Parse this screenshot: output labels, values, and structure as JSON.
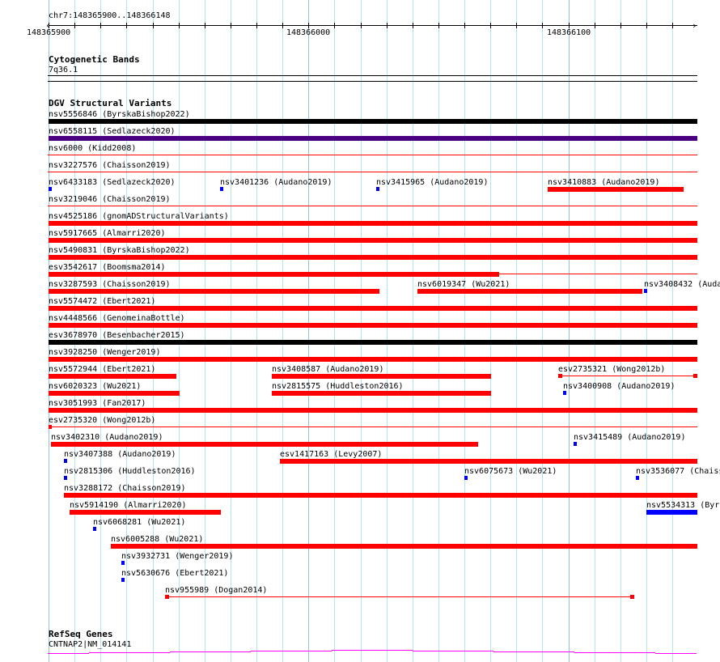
{
  "ruler": {
    "location": "chr7:148365900..148366148",
    "tick_labels": [
      "148365900",
      "148366000",
      "148366100"
    ]
  },
  "cytoband": {
    "title": "Cytogenetic Bands",
    "band": "7q36.1"
  },
  "dgv": {
    "title": "DGV Structural Variants",
    "colors": {
      "red": "#ff0000",
      "blue": "#0000ff",
      "black": "#000000",
      "purple": "#4b0082"
    },
    "rows": [
      {
        "items": [
          {
            "label": "nsv5556846 (ByrskaBishop2022)",
            "color": "#000000"
          }
        ]
      },
      {
        "items": [
          {
            "label": "nsv6558115 (Sedlazeck2020)",
            "color": "#4b0082"
          }
        ]
      },
      {
        "items": [
          {
            "label": "nsv6000 (Kidd2008)",
            "color": "#ff0000"
          }
        ]
      },
      {
        "items": [
          {
            "label": "nsv3227576 (Chaisson2019)",
            "color": "#ff0000"
          }
        ]
      },
      {
        "items": [
          {
            "label": "nsv6433183 (Sedlazeck2020)",
            "color": "#0000ff"
          },
          {
            "label": "nsv3401236 (Audano2019)",
            "color": "#0000ff"
          },
          {
            "label": "nsv3415965 (Audano2019)",
            "color": "#0000ff"
          },
          {
            "label": "nsv3410883 (Audano2019)",
            "color": "#ff0000"
          }
        ]
      },
      {
        "items": [
          {
            "label": "nsv3219046 (Chaisson2019)",
            "color": "#ff0000"
          }
        ]
      },
      {
        "items": [
          {
            "label": "nsv4525186 (gnomADStructuralVariants)",
            "color": "#ff0000"
          }
        ]
      },
      {
        "items": [
          {
            "label": "nsv5917665 (Almarri2020)",
            "color": "#ff0000"
          }
        ]
      },
      {
        "items": [
          {
            "label": "nsv5490831 (ByrskaBishop2022)",
            "color": "#ff0000"
          }
        ]
      },
      {
        "items": [
          {
            "label": "esv3542617 (Boomsma2014)",
            "color": "#ff0000"
          }
        ]
      },
      {
        "items": [
          {
            "label": "nsv3287593 (Chaisson2019)",
            "color": "#ff0000"
          },
          {
            "label": "nsv6019347 (Wu2021)",
            "color": "#ff0000"
          },
          {
            "label": "nsv3408432 (Auda",
            "color": "#0000ff"
          }
        ]
      },
      {
        "items": [
          {
            "label": "nsv5574472 (Ebert2021)",
            "color": "#ff0000"
          }
        ]
      },
      {
        "items": [
          {
            "label": "nsv4448566 (GenomeinaBottle)",
            "color": "#ff0000"
          }
        ]
      },
      {
        "items": [
          {
            "label": "esv3678970 (Besenbacher2015)",
            "color": "#000000"
          }
        ]
      },
      {
        "items": [
          {
            "label": "nsv3928250 (Wenger2019)",
            "color": "#ff0000"
          }
        ]
      },
      {
        "items": [
          {
            "label": "nsv5572944 (Ebert2021)",
            "color": "#ff0000"
          },
          {
            "label": "nsv3408587 (Audano2019)",
            "color": "#ff0000"
          },
          {
            "label": "esv2735321 (Wong2012b)",
            "color": "#ff0000"
          }
        ]
      },
      {
        "items": [
          {
            "label": "nsv6020323 (Wu2021)",
            "color": "#ff0000"
          },
          {
            "label": "nsv2815575 (Huddleston2016)",
            "color": "#ff0000"
          },
          {
            "label": "nsv3400908 (Audano2019)",
            "color": "#0000ff"
          }
        ]
      },
      {
        "items": [
          {
            "label": "nsv3051993 (Fan2017)",
            "color": "#ff0000"
          }
        ]
      },
      {
        "items": [
          {
            "label": "esv2735320 (Wong2012b)",
            "color": "#ff0000"
          }
        ]
      },
      {
        "items": [
          {
            "label": "nsv3402310 (Audano2019)",
            "color": "#ff0000"
          },
          {
            "label": "nsv3415489 (Audano2019)",
            "color": "#0000ff"
          }
        ]
      },
      {
        "items": [
          {
            "label": "nsv3407388 (Audano2019)",
            "color": "#0000ff"
          },
          {
            "label": "esv1417163 (Levy2007)",
            "color": "#ff0000"
          }
        ]
      },
      {
        "items": [
          {
            "label": "nsv2815306 (Huddleston2016)",
            "color": "#0000ff"
          },
          {
            "label": "nsv6075673 (Wu2021)",
            "color": "#0000ff"
          },
          {
            "label": "nsv3536077 (Chaiss",
            "color": "#0000ff"
          }
        ]
      },
      {
        "items": [
          {
            "label": "nsv3288172 (Chaisson2019)",
            "color": "#ff0000"
          }
        ]
      },
      {
        "items": [
          {
            "label": "nsv5914190 (Almarri2020)",
            "color": "#ff0000"
          },
          {
            "label": "nsv5534313 (Byrs",
            "color": "#0000ff"
          }
        ]
      },
      {
        "items": [
          {
            "label": "nsv6068281 (Wu2021)",
            "color": "#0000ff"
          }
        ]
      },
      {
        "items": [
          {
            "label": "nsv6005288 (Wu2021)",
            "color": "#ff0000"
          }
        ]
      },
      {
        "items": [
          {
            "label": "nsv3932731 (Wenger2019)",
            "color": "#0000ff"
          }
        ]
      },
      {
        "items": [
          {
            "label": "nsv5630676 (Ebert2021)",
            "color": "#0000ff"
          }
        ]
      },
      {
        "items": [
          {
            "label": "nsv955989 (Dogan2014)",
            "color": "#ff0000"
          }
        ]
      }
    ]
  },
  "refseq": {
    "title": "RefSeq Genes",
    "gene": "CNTNAP2|NM_014141",
    "color": "#ff00ff"
  }
}
